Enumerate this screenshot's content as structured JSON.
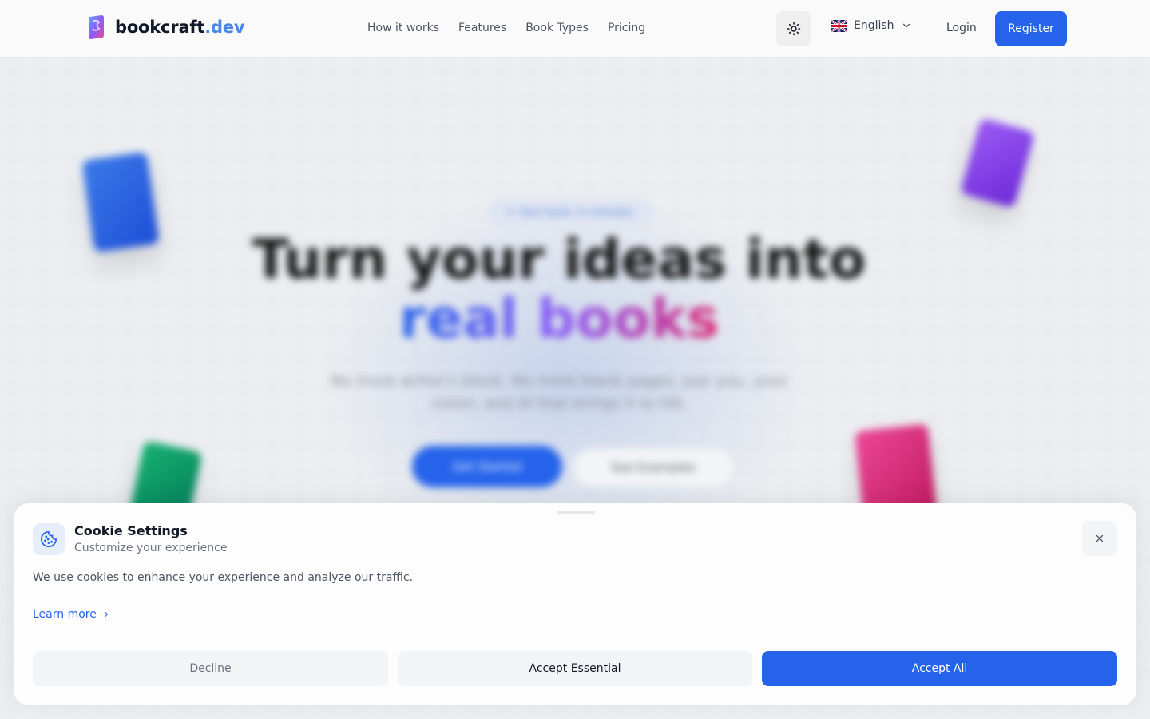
{
  "header": {
    "logo_name": "bookcraft",
    "logo_tld": ".dev",
    "nav": [
      "How it works",
      "Features",
      "Book Types",
      "Pricing"
    ],
    "theme_icon": "sun-icon",
    "language": "English",
    "login": "Login",
    "register": "Register"
  },
  "hero": {
    "badge": "Your book. In minutes.",
    "title_line1": "Turn your ideas into",
    "title_line2": "real books",
    "subtitle": "No more writer's block. No more blank pages. Just you, your vision, and AI that brings it to life.",
    "cta_primary": "Get Started",
    "cta_secondary": "See Examples"
  },
  "cookie": {
    "title": "Cookie Settings",
    "subtitle": "Customize your experience",
    "text": "We use cookies to enhance your experience and analyze our traffic.",
    "learn_more": "Learn more",
    "decline": "Decline",
    "accept_essential": "Accept Essential",
    "accept_all": "Accept All"
  },
  "colors": {
    "accent": "#2563eb",
    "logo_tld": "#4a86e8"
  }
}
